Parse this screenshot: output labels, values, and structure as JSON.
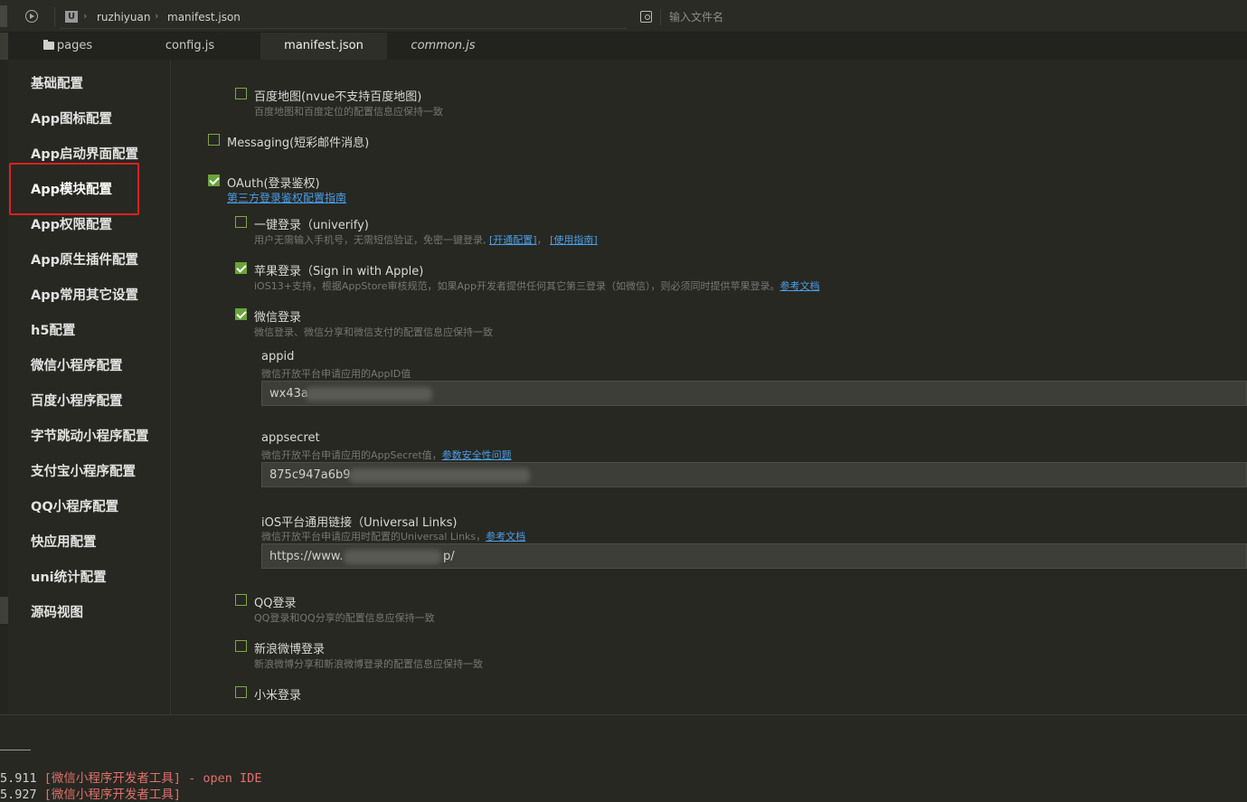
{
  "topbar": {
    "breadcrumb": [
      "ruzhiyuan",
      "manifest.json"
    ],
    "search_placeholder": "输入文件名"
  },
  "tabs": [
    {
      "label": "pages",
      "icon": "folder-icon"
    },
    {
      "label": "config.js"
    },
    {
      "label": "manifest.json",
      "active": true
    },
    {
      "label": "common.js",
      "italic": true
    }
  ],
  "sidebar": {
    "items": [
      "基础配置",
      "App图标配置",
      "App启动界面配置",
      "App模块配置",
      "App权限配置",
      "App原生插件配置",
      "App常用其它设置",
      "h5配置",
      "微信小程序配置",
      "百度小程序配置",
      "字节跳动小程序配置",
      "支付宝小程序配置",
      "QQ小程序配置",
      "快应用配置",
      "uni统计配置",
      "源码视图"
    ],
    "active_index": 3
  },
  "content": {
    "baidu_map": {
      "label": "百度地图(nvue不支持百度地图)",
      "desc": "百度地图和百度定位的配置信息应保持一致",
      "checked": false
    },
    "messaging": {
      "label": "Messaging(短彩邮件消息)",
      "checked": false
    },
    "oauth": {
      "label": "OAuth(登录鉴权)",
      "guide_link": "第三方登录鉴权配置指南",
      "checked": true
    },
    "univerify": {
      "label": "一键登录（univerify)",
      "desc": "用户无需输入手机号，无需短信验证，免密一键登录,",
      "link1": "[开通配置]",
      "sep": "，",
      "link2": "[使用指南]",
      "checked": false
    },
    "apple": {
      "label": "苹果登录（Sign in with Apple)",
      "desc": "iOS13+支持，根据AppStore审核规范，如果App开发者提供任何其它第三登录（如微信），则必须同时提供苹果登录。",
      "link": "参考文档",
      "checked": true
    },
    "weixin": {
      "label": "微信登录",
      "desc": "微信登录、微信分享和微信支付的配置信息应保持一致",
      "checked": true,
      "appid": {
        "label": "appid",
        "desc": "微信开放平台申请应用的AppID值",
        "value": "wx43a"
      },
      "appsecret": {
        "label": "appsecret",
        "desc": "微信开放平台申请应用的AppSecret值，",
        "link": "参数安全性问题",
        "value": "875c947a6b9"
      },
      "universal_links": {
        "label": "iOS平台通用链接（Universal Links)",
        "desc": "微信开放平台申请应用时配置的Universal Links，",
        "link": "参考文档",
        "value_prefix": "https://www.",
        "value_suffix": "p/"
      }
    },
    "qq": {
      "label": "QQ登录",
      "desc": "QQ登录和QQ分享的配置信息应保持一致",
      "checked": false
    },
    "sina": {
      "label": "新浪微博登录",
      "desc": "新浪微博分享和新浪微博登录的配置信息应保持一致",
      "checked": false
    },
    "xiaomi": {
      "label": "小米登录",
      "checked": false
    }
  },
  "console": {
    "lines": [
      {
        "time": "5.911",
        "msg": "[微信小程序开发者工具] - open IDE"
      },
      {
        "time": "5.927",
        "msg": "[微信小程序开发者工具]"
      }
    ]
  },
  "colors": {
    "accent_green": "#6aa33a",
    "link_blue": "#4c9ee8",
    "highlight_red": "#e02020",
    "console_red": "#e0706a"
  }
}
